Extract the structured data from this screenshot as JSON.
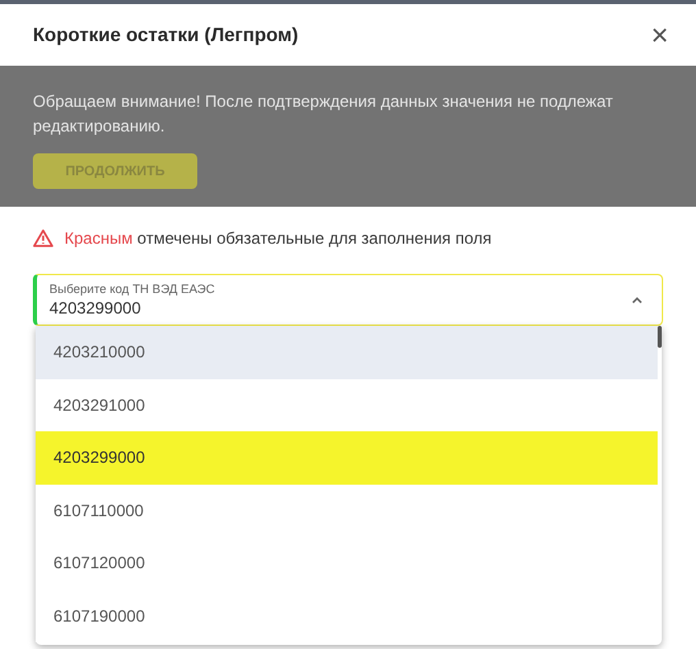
{
  "dialog": {
    "title": "Короткие остатки (Легпром)",
    "close": "×"
  },
  "notice": {
    "text": "Обращаем внимание! После подтверждения данных значения не подлежат редактированию.",
    "button": "ПРОДОЛЖИТЬ"
  },
  "warning": {
    "text": "**Красным** отмечены обязательные для заполнения поля"
  },
  "select": {
    "label": "Выберите код ТН ВЭД ЕАЭС",
    "value": "4203299000",
    "expanded": true,
    "options": [
      {
        "label": "4203210000",
        "highlighted": true,
        "selected": false
      },
      {
        "label": "4203291000",
        "highlighted": false,
        "selected": false
      },
      {
        "label": "4203299000",
        "highlighted": false,
        "selected": true
      },
      {
        "label": "6107110000",
        "highlighted": false,
        "selected": false
      },
      {
        "label": "6107120000",
        "highlighted": false,
        "selected": false
      },
      {
        "label": "6107190000",
        "highlighted": false,
        "selected": false
      }
    ]
  }
}
